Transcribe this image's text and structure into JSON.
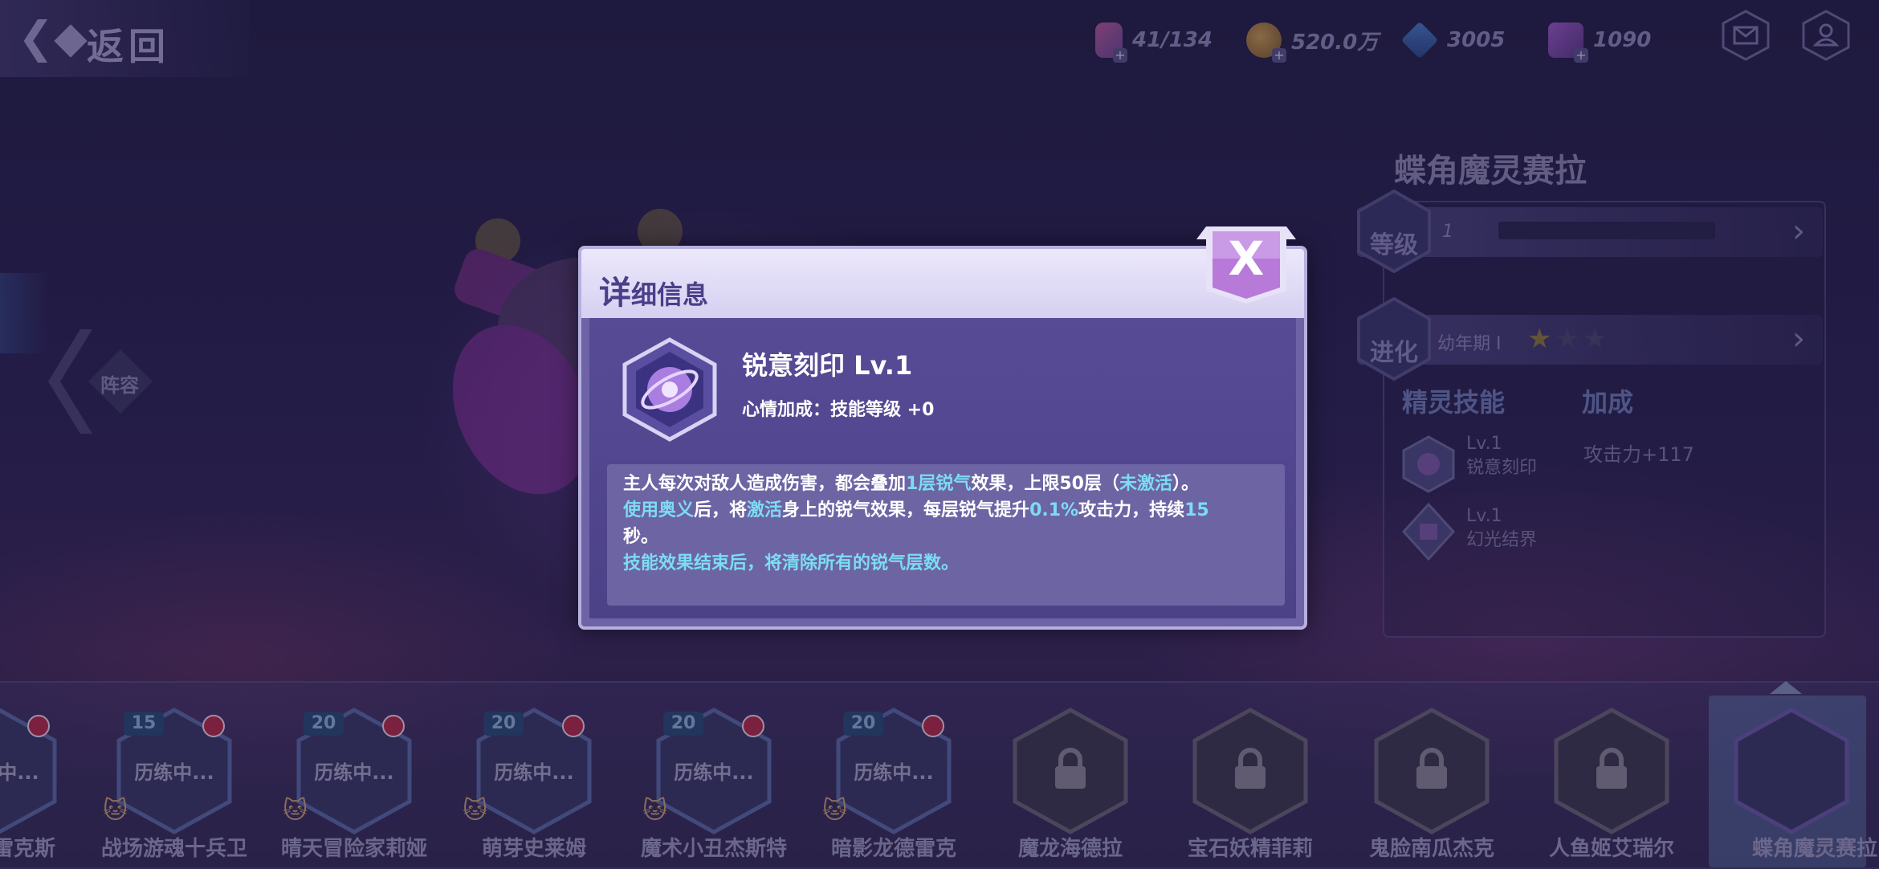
{
  "header": {
    "back_label": "返回",
    "resources": [
      {
        "icon": "stamina-potion-icon",
        "value": "41/134"
      },
      {
        "icon": "gold-coin-icon",
        "value": "520.0万"
      },
      {
        "icon": "blue-crystal-icon",
        "value": "3005"
      },
      {
        "icon": "purple-gem-icon",
        "value": "1090"
      }
    ],
    "mail_icon": "mail-icon",
    "profile_icon": "profile-icon"
  },
  "lineup_label": "阵容",
  "spirit": {
    "name": "蝶角魔灵赛拉",
    "level_label": "等级",
    "level_value": "1",
    "evolution_label": "进化",
    "evolution_stage": "幼年期 I",
    "stars_filled": 1,
    "stars_total": 3,
    "skills_heading": "精灵技能",
    "bonus_heading": "加成",
    "skills": [
      {
        "level": "Lv.1",
        "name": "锐意刻印"
      },
      {
        "level": "Lv.1",
        "name": "幻光结界"
      }
    ],
    "bonus_value": "攻击力+117"
  },
  "dialog": {
    "title_first": "详",
    "title_rest": "细信息",
    "close_label": "X",
    "skill_name": "锐意刻印 Lv.1",
    "mood_bonus": "心情加成：技能等级 +0",
    "desc": {
      "l1a": "主人每次对敌人造成伤害，都会叠加",
      "l1b": "1层锐气",
      "l1c": "效果，上限50层（",
      "l1d": "未激活",
      "l1e": "）。",
      "l2a": "使用奥义",
      "l2b": "后，将",
      "l2c": "激活",
      "l2d": "身上的锐气效果，每层锐气提升",
      "l2e": "0.1%",
      "l2f": "攻击力，持续",
      "l2g": "15",
      "l3": "秒。",
      "l4": "技能效果结束后，将清除所有的锐气层数。"
    }
  },
  "roster": {
    "training_label": "历练中...",
    "cards": [
      {
        "name": "雷克斯",
        "level": "",
        "training": true,
        "locked": false
      },
      {
        "name": "战场游魂十兵卫",
        "level": "15",
        "training": true,
        "locked": false
      },
      {
        "name": "晴天冒险家莉娅",
        "level": "20",
        "training": true,
        "locked": false
      },
      {
        "name": "萌芽史莱姆",
        "level": "20",
        "training": true,
        "locked": false
      },
      {
        "name": "魔术小丑杰斯特",
        "level": "20",
        "training": true,
        "locked": false
      },
      {
        "name": "暗影龙德雷克",
        "level": "20",
        "training": true,
        "locked": false
      },
      {
        "name": "魔龙海德拉",
        "level": "",
        "training": false,
        "locked": true
      },
      {
        "name": "宝石妖精菲莉",
        "level": "",
        "training": false,
        "locked": true
      },
      {
        "name": "鬼脸南瓜杰克",
        "level": "",
        "training": false,
        "locked": true
      },
      {
        "name": "人鱼姬艾瑞尔",
        "level": "",
        "training": false,
        "locked": true
      },
      {
        "name": "蝶角魔灵赛拉",
        "level": "",
        "training": false,
        "locked": false,
        "selected": true
      }
    ]
  },
  "colors": {
    "highlight": "#7cdcf2",
    "dialog_header": "#e4e0f8",
    "dialog_body": "#574b96",
    "close_button": "#b77ad8"
  }
}
